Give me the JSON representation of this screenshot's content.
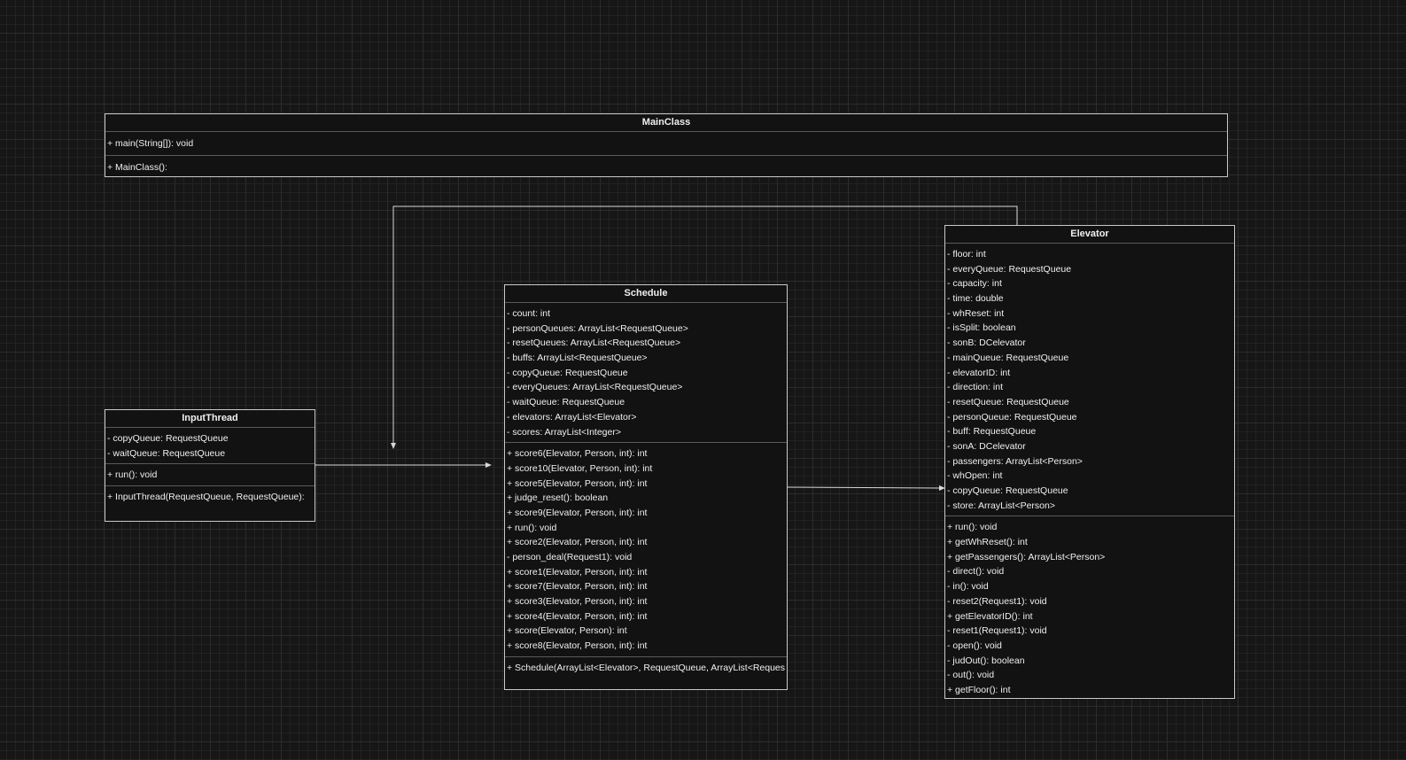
{
  "classes": [
    {
      "key": "mainclass",
      "name": "MainClass",
      "attributes": [],
      "sections": [
        [
          "+ main(String[]): void"
        ],
        [
          "+ MainClass():"
        ]
      ]
    },
    {
      "key": "inputthread",
      "name": "InputThread",
      "attributes": [
        "- copyQueue: RequestQueue",
        "- waitQueue: RequestQueue"
      ],
      "sections": [
        [
          "+ run(): void"
        ],
        [
          "+ InputThread(RequestQueue, RequestQueue):"
        ]
      ]
    },
    {
      "key": "schedule",
      "name": "Schedule",
      "attributes": [
        "- count: int",
        "- personQueues: ArrayList<RequestQueue>",
        "- resetQueues: ArrayList<RequestQueue>",
        "- buffs: ArrayList<RequestQueue>",
        "- copyQueue: RequestQueue",
        "- everyQueues: ArrayList<RequestQueue>",
        "- waitQueue: RequestQueue",
        "- elevators: ArrayList<Elevator>",
        "- scores: ArrayList<Integer>"
      ],
      "sections": [
        [
          "+ score6(Elevator, Person, int): int",
          "+ score10(Elevator, Person, int): int",
          "+ score5(Elevator, Person, int): int",
          "+ judge_reset(): boolean",
          "+ score9(Elevator, Person, int): int",
          "+ run(): void",
          "+ score2(Elevator, Person, int): int",
          "- person_deal(Request1): void",
          "+ score1(Elevator, Person, int): int",
          "+ score7(Elevator, Person, int): int",
          "+ score3(Elevator, Person, int): int",
          "+ score4(Elevator, Person, int): int",
          "+ score(Elevator, Person): int",
          "+ score8(Elevator, Person, int): int"
        ],
        [
          "+ Schedule(ArrayList<Elevator>, RequestQueue, ArrayList<RequestQueue>"
        ]
      ]
    },
    {
      "key": "elevator",
      "name": "Elevator",
      "attributes": [
        "- floor: int",
        "- everyQueue: RequestQueue",
        "- capacity: int",
        "- time: double",
        "- whReset: int",
        "- isSplit: boolean",
        "- sonB: DCelevator",
        "- mainQueue: RequestQueue",
        "- elevatorID: int",
        "- direction: int",
        "- resetQueue: RequestQueue",
        "- personQueue: RequestQueue",
        "- buff: RequestQueue",
        "- sonA: DCelevator",
        "- passengers: ArrayList<Person>",
        "- whOpen: int",
        "- copyQueue: RequestQueue",
        "- store: ArrayList<Person>"
      ],
      "sections": [
        [
          "+ run(): void",
          "+ getWhReset(): int",
          "+ getPassengers(): ArrayList<Person>",
          "- direct(): void",
          "- in(): void",
          "- reset2(Request1): void",
          "+ getElevatorID(): int",
          "- reset1(Request1): void",
          "- open(): void",
          "- judOut(): boolean",
          "- out(): void",
          "+ getFloor(): int"
        ]
      ]
    }
  ],
  "connections": [
    {
      "from": "inputthread",
      "to": "schedule"
    },
    {
      "from": "schedule",
      "to": "elevator"
    },
    {
      "from": "elevator",
      "to": "schedule-region"
    }
  ]
}
